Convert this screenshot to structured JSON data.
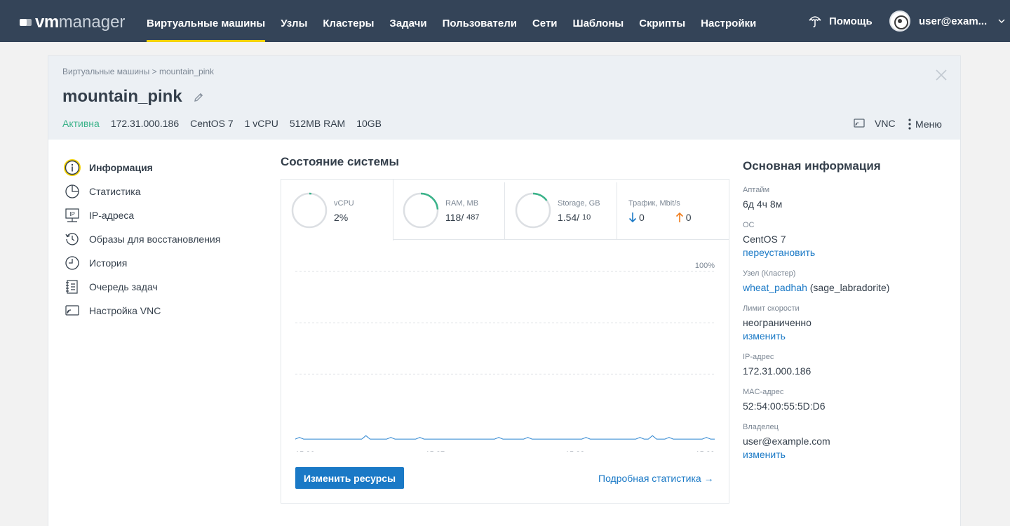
{
  "topbar": {
    "logo_vm": "vm",
    "logo_manager": "manager",
    "nav": [
      {
        "label": "Виртуальные машины",
        "active": true
      },
      {
        "label": "Узлы"
      },
      {
        "label": "Кластеры"
      },
      {
        "label": "Задачи"
      },
      {
        "label": "Пользователи"
      },
      {
        "label": "Сети"
      },
      {
        "label": "Шаблоны"
      },
      {
        "label": "Скрипты"
      },
      {
        "label": "Настройки"
      }
    ],
    "help_label": "Помощь",
    "user_label": "user@exam..."
  },
  "header": {
    "breadcrumb": "Виртуальные машины > mountain_pink",
    "title": "mountain_pink",
    "status": "Активна",
    "ip": "172.31.000.186",
    "os": "CentOS 7",
    "cpu": "1 vCPU",
    "ram": "512MB RAM",
    "disk": "10GB",
    "vnc_label": "VNC",
    "menu_label": "Меню"
  },
  "side_menu": [
    {
      "label": "Информация",
      "icon": "info-icon",
      "active": true
    },
    {
      "label": "Статистика",
      "icon": "pie-chart-icon"
    },
    {
      "label": "IP-адреса",
      "icon": "ip-icon"
    },
    {
      "label": "Образы для восстановления",
      "icon": "restore-icon"
    },
    {
      "label": "История",
      "icon": "clock-icon"
    },
    {
      "label": "Очередь задач",
      "icon": "task-queue-icon"
    },
    {
      "label": "Настройка VNC",
      "icon": "vnc-icon"
    }
  ],
  "system": {
    "title": "Состояние системы",
    "tiles": {
      "vcpu": {
        "label": "vCPU",
        "value": "2%",
        "fraction": 0.02
      },
      "ram": {
        "label": "RAM, MB",
        "used": "118",
        "total": "487",
        "fraction": 0.24
      },
      "storage": {
        "label": "Storage, GB",
        "used": "1.54",
        "total": "10",
        "fraction": 0.15
      },
      "traffic": {
        "label": "Трафик, Mbit/s",
        "down": "0",
        "up": "0"
      }
    },
    "resize_button": "Изменить ресурсы",
    "detail_link": "Подробная статистика →"
  },
  "colors": {
    "accent": "#1a79c6",
    "active_status": "#3bb38a",
    "gauge": "#3bb38a",
    "nav_bg": "#344458",
    "nav_active": "#f3d200",
    "traffic_down": "#1a79c6",
    "traffic_up": "#f07d1c"
  },
  "chart_data": {
    "type": "line",
    "x": [
      "15:36",
      "15:37",
      "15:38",
      "15:39"
    ],
    "y_max_label": "100%",
    "ylim": [
      0,
      100
    ],
    "grid": true,
    "series": [
      {
        "values": [
          2,
          3,
          2,
          2,
          2,
          2,
          2,
          2,
          2,
          2,
          2,
          2,
          2,
          2,
          2,
          2,
          2,
          4,
          2,
          2,
          2,
          2,
          2,
          3,
          2,
          2,
          2,
          2,
          2,
          2,
          3,
          2,
          2,
          2,
          2,
          2,
          2,
          2,
          2,
          2,
          2,
          2,
          2,
          2,
          2,
          2,
          2,
          2,
          2,
          3,
          2,
          2,
          2,
          2,
          2,
          2,
          3,
          2,
          2,
          2,
          2,
          2,
          2,
          2,
          2,
          2,
          2,
          2,
          2,
          2,
          3,
          2,
          2,
          2,
          2,
          2,
          2,
          2,
          2,
          2,
          2,
          2,
          2,
          3,
          2,
          2,
          4,
          2,
          2,
          2,
          3,
          2,
          2,
          2,
          2,
          2,
          2,
          2,
          2,
          3,
          2,
          2
        ]
      }
    ]
  },
  "basic_info": {
    "title": "Основная информация",
    "uptime_label": "Аптайм",
    "uptime": "6д 4ч 8м",
    "os_label": "ОС",
    "os": "CentOS 7",
    "os_link": "переустановить",
    "node_label": "Узел (Кластер)",
    "node": "wheat_padhah",
    "cluster": "(sage_labradorite)",
    "speed_label": "Лимит скорости",
    "speed": "неограниченно",
    "speed_link": "изменить",
    "ip_label": "IP-адрес",
    "ip": "172.31.000.186",
    "mac_label": "MAC-адрес",
    "mac": "52:54:00:55:5D:D6",
    "owner_label": "Владелец",
    "owner": "user@example.com",
    "owner_link": "изменить"
  }
}
